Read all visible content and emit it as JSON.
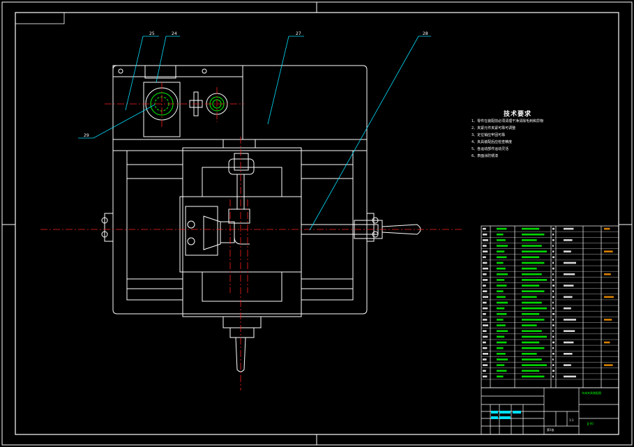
{
  "tech_requirements": {
    "title": "技术要求",
    "items": [
      "1、零件在装配前必须清理干净清除毛刺和异物",
      "2、夹紧元件夹紧可靠可调整",
      "3、定位销应牢固可靠",
      "4、夹具装配后应检查精度",
      "5、各运动部件运动灵活",
      "6、表面涂防锈漆"
    ]
  },
  "callouts": {
    "c25": "25",
    "c24": "24",
    "c27": "27",
    "c28": "28",
    "c29": "29"
  },
  "title_block": {
    "design_name": "车床夹具装配图",
    "drawing_no": "JJ-00",
    "scale": "1:1",
    "sheet": "第1张"
  }
}
